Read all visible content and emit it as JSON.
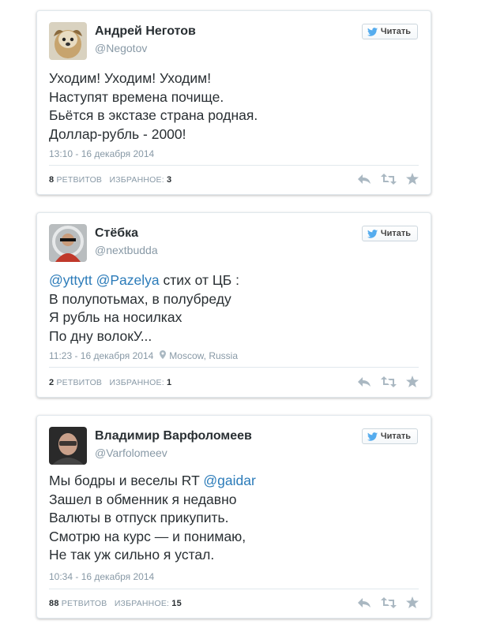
{
  "follow_label": "Читать",
  "colors": {
    "link": "#2b7bb9",
    "muted": "#8899a6",
    "text": "#292f33",
    "bird": "#55acee"
  },
  "tweets": [
    {
      "name": "Андрей Неготов",
      "handle": "@Negotov",
      "lines": [
        "Уходим! Уходим! Уходим!",
        "Наступят времена почище.",
        "Бьётся в экстазе страна родная.",
        "Доллар-рубль - 2000!"
      ],
      "time": "13:10 - 16 декабря 2014",
      "retweets": "8",
      "retweets_label": "ретвитов",
      "favorites_label": "избранное:",
      "favorites": "3"
    },
    {
      "name": "Стёбка",
      "handle": "@nextbudda",
      "mention1": "@yttytt",
      "mention2": "@Pazelya",
      "line1_rest": " стих от ЦБ :",
      "lines": [
        "В полупотьмах, в полубреду",
        "Я рубль на носилках",
        "По дну волокУ..."
      ],
      "time": "11:23 - 16 декабря 2014",
      "location": "Moscow, Russia",
      "retweets": "2",
      "retweets_label": "ретвитов",
      "favorites_label": "избранное:",
      "favorites": "1"
    },
    {
      "name": "Владимир Варфоломеев",
      "handle": "@Varfolomeev",
      "line1_start": "Мы бодры и веселы RT ",
      "mention": "@gaidar",
      "lines": [
        "Зашел в обменник я недавно",
        "Валюты в отпуск прикупить.",
        "Смотрю на курс — и понимаю,",
        "Не так уж сильно я устал."
      ],
      "time": "10:34 - 16 декабря 2014",
      "retweets": "88",
      "retweets_label": "ретвитов",
      "favorites_label": "избранное:",
      "favorites": "15"
    }
  ]
}
